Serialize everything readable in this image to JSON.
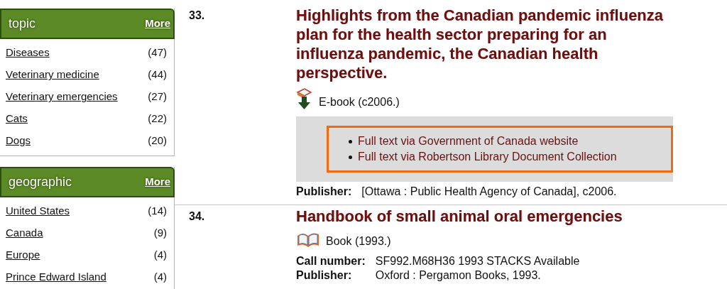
{
  "facets": [
    {
      "title": "topic",
      "more": "More",
      "items": [
        {
          "label": "Diseases",
          "count": "(47)"
        },
        {
          "label": "Veterinary medicine",
          "count": "(44)"
        },
        {
          "label": "Veterinary emergencies",
          "count": "(27)"
        },
        {
          "label": "Cats",
          "count": "(22)"
        },
        {
          "label": "Dogs",
          "count": "(20)"
        }
      ]
    },
    {
      "title": "geographic",
      "more": "More",
      "items": [
        {
          "label": "United States",
          "count": "(14)"
        },
        {
          "label": "Canada",
          "count": "(9)"
        },
        {
          "label": "Europe",
          "count": "(4)"
        },
        {
          "label": "Prince Edward Island",
          "count": "(4)"
        }
      ]
    }
  ],
  "results": [
    {
      "number": "33.",
      "title": "Highlights from the Canadian pandemic influenza plan for the health sector preparing for an influenza pandemic, the Canadian health perspective.",
      "format": {
        "kind": "ebook",
        "label": "E-book (c2006.)"
      },
      "links": [
        "Full text via Government of Canada website",
        "Full text via Robertson Library Document Collection"
      ],
      "fields": [
        {
          "label": "Publisher:",
          "value": "[Ottawa : Public Health Agency of Canada], c2006."
        }
      ]
    },
    {
      "number": "34.",
      "title": "Handbook of small animal oral emergencies",
      "format": {
        "kind": "book",
        "label": "Book (1993.)"
      },
      "fields": [
        {
          "label": "Call number:",
          "value": "SF992.M68H36 1993 STACKS Available"
        },
        {
          "label": "Publisher:",
          "value": "Oxford : Pergamon Books, 1993."
        }
      ]
    }
  ]
}
